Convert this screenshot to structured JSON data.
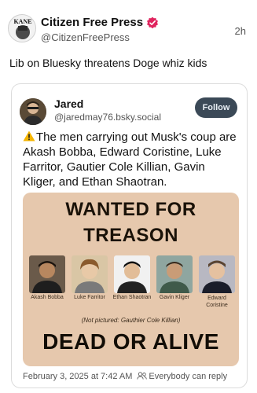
{
  "post": {
    "author_name": "Citizen Free Press",
    "author_handle": "@CitizenFreePress",
    "time": "2h",
    "avatar_text": "KANE",
    "text": "Lib on Bluesky threatens Doge whiz kids"
  },
  "quote": {
    "name": "Jared",
    "handle": "@jaredmay76.bsky.social",
    "follow_label": "Follow",
    "body": "The men carrying out Musk's coup are Akash Bobba, Edward Coristine, Luke Farritor, Gautier Cole Killian, Gavin Kliger, and Ethan Shaotran.",
    "date": "February 3, 2025 at 7:42 AM",
    "visibility": "Everybody can reply"
  },
  "poster": {
    "title_line1": "WANTED FOR",
    "title_line2": "TREASON",
    "names": [
      "Akash Bobba",
      "Luke Farritor",
      "Ethan Shaotran",
      "Gavin Kliger",
      "Edward Coristine"
    ],
    "not_pictured": "(Not pictured: Gauthier Cole Killian)",
    "bottom_text": "DEAD OR ALIVE"
  },
  "colors": {
    "verified_badge": "#e0245e",
    "follow_button": "#3b4957",
    "poster_background": "#e6c8ad"
  },
  "icons": [
    "verified-badge-icon",
    "warning-icon",
    "people-icon"
  ]
}
